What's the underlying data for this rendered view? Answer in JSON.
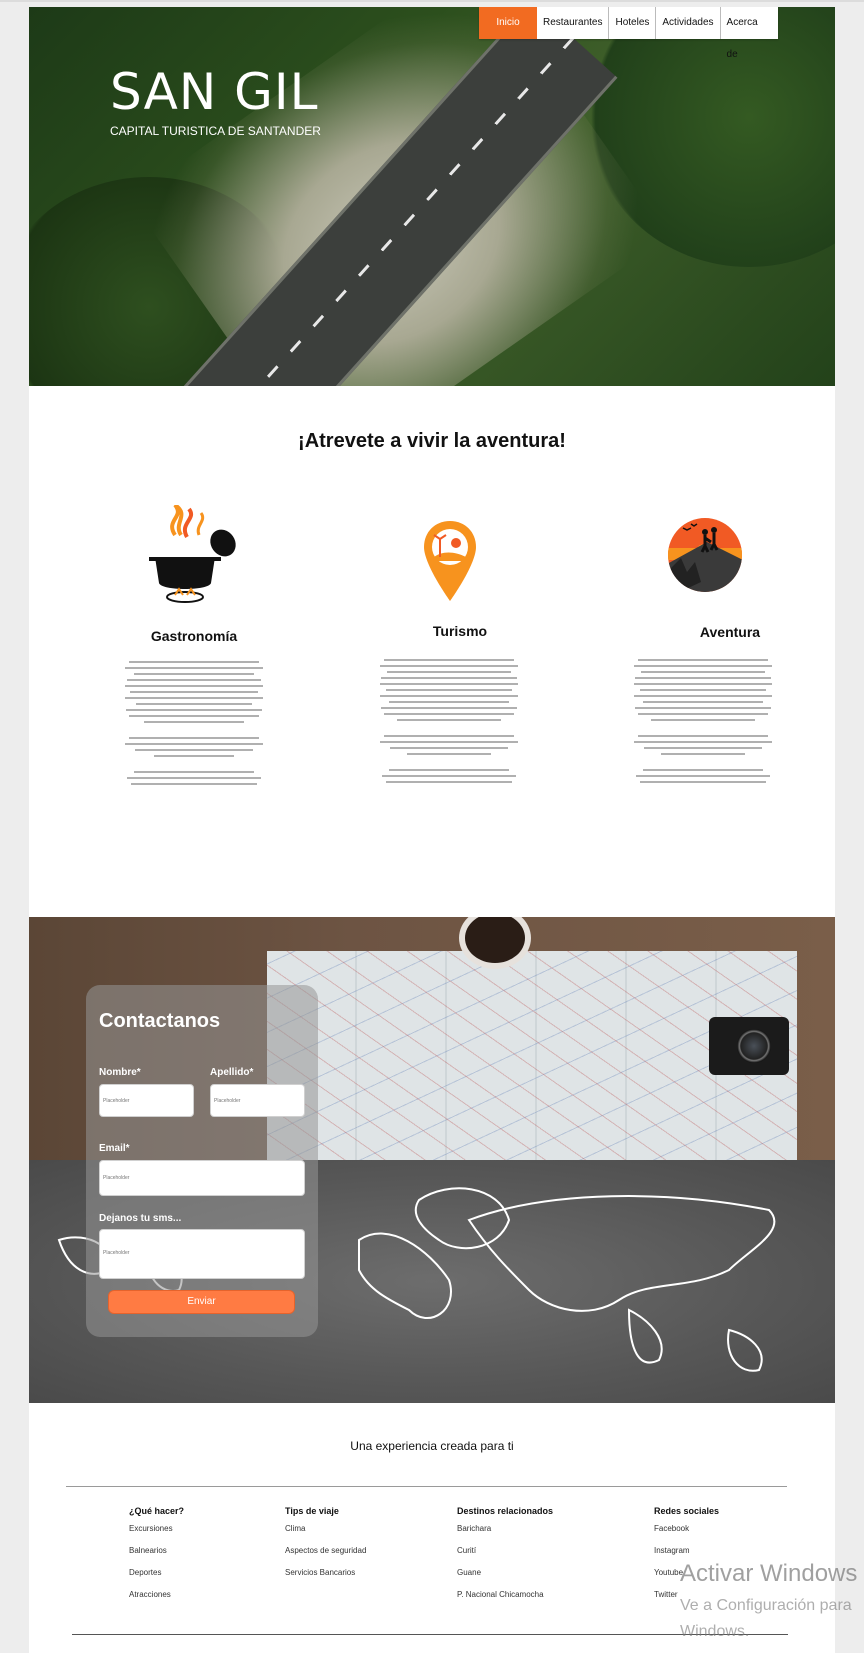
{
  "nav": {
    "items": [
      {
        "label": "Inicio"
      },
      {
        "label": "Restaurantes"
      },
      {
        "label": "Hoteles"
      },
      {
        "label": "Actividades"
      },
      {
        "label": "Acerca de"
      }
    ],
    "accent_color": "#f26b21"
  },
  "hero": {
    "title": "SAN GIL",
    "subtitle": "CAPITAL TURISTICA DE SANTANDER"
  },
  "features": {
    "headline": "¡Atrevete a vivir la aventura!",
    "items": [
      {
        "title": "Gastronomía",
        "icon": "cooking-pot-icon"
      },
      {
        "title": "Turismo",
        "icon": "map-pin-beach-icon"
      },
      {
        "title": "Aventura",
        "icon": "hikers-sunset-icon"
      }
    ]
  },
  "contact": {
    "title": "Contactanos",
    "nombre_label": "Nombre*",
    "apellido_label": "Apellido*",
    "email_label": "Email*",
    "message_label": "Dejanos tu sms...",
    "placeholder": "Placeholder",
    "submit_label": "Enviar",
    "button_color": "#ff7b43"
  },
  "footer": {
    "tagline": "Una experiencia creada para ti",
    "columns": [
      {
        "title": "¿Qué hacer?",
        "links": [
          "Excursiones",
          "Balnearios",
          "Deportes",
          "Atracciones"
        ]
      },
      {
        "title": "Tips de viaje",
        "links": [
          "Clima",
          "Aspectos de seguridad",
          "Servicios Bancarios"
        ]
      },
      {
        "title": "Destinos relacionados",
        "links": [
          "Barichara",
          "Curití",
          "Guane",
          "P. Nacional Chicamocha"
        ]
      },
      {
        "title": "Redes sociales",
        "links": [
          "Facebook",
          "Instagram",
          "Youtube",
          "Twitter"
        ]
      }
    ]
  },
  "watermark": {
    "line1": "Activar Windows",
    "line2": "Ve a Configuración para",
    "line3": "Windows."
  }
}
